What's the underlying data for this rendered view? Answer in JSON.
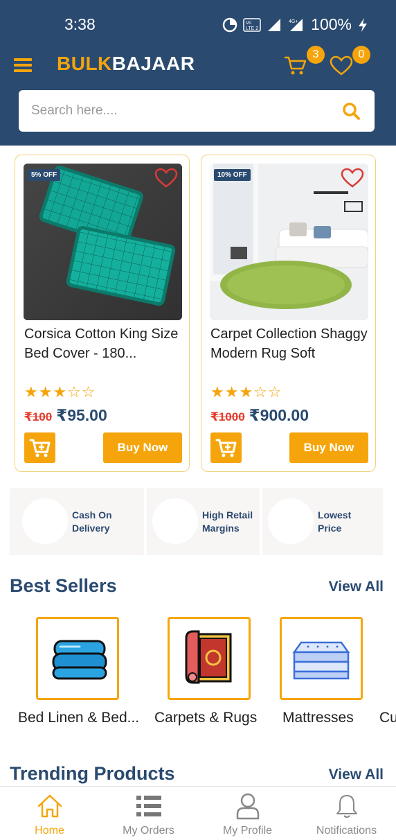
{
  "status_bar": {
    "time": "3:38",
    "volte": "Vo LTE 2",
    "network": "4G+",
    "battery": "100%"
  },
  "header": {
    "brand_part1": "BULK",
    "brand_part2": "BAJAAR",
    "cart_count": "3",
    "wishlist_count": "0"
  },
  "search": {
    "placeholder": "Search here...."
  },
  "products": [
    {
      "discount": "5% OFF",
      "name": "Corsica Cotton King Size Bed Cover - 180...",
      "rating": 3,
      "rating_max": 5,
      "stars": "★★★☆☆",
      "price_old": "₹100",
      "price_new": "₹95.00",
      "buy_label": "Buy Now"
    },
    {
      "discount": "10% OFF",
      "name": "Carpet Collection Shaggy Modern Rug Soft",
      "rating": 3,
      "rating_max": 5,
      "stars": "★★★☆☆",
      "price_old": "₹1000",
      "price_new": "₹900.00",
      "buy_label": "Buy Now"
    }
  ],
  "features": [
    {
      "line1": "Cash On",
      "line2": "Delivery"
    },
    {
      "line1": "High Retail",
      "line2": "Margins"
    },
    {
      "line1": "Lowest",
      "line2": "Price"
    }
  ],
  "best_sellers": {
    "title": "Best Sellers",
    "view_all": "View All",
    "categories": [
      {
        "label": "Bed Linen & Bed...",
        "icon": "bed-linen-icon"
      },
      {
        "label": "Carpets & Rugs",
        "icon": "carpet-icon"
      },
      {
        "label": "Mattresses",
        "icon": "mattress-icon"
      },
      {
        "label": "Cu",
        "icon": ""
      }
    ]
  },
  "trending": {
    "title": "Trending Products",
    "view_all": "View All"
  },
  "bottom_nav": [
    {
      "label": "Home",
      "icon": "home-icon",
      "active": true
    },
    {
      "label": "My Orders",
      "icon": "list-icon",
      "active": false
    },
    {
      "label": "My Profile",
      "icon": "user-icon",
      "active": false
    },
    {
      "label": "Notifications",
      "icon": "bell-icon",
      "active": false
    }
  ],
  "colors": {
    "primary": "#2a4a70",
    "accent": "#f5a50b",
    "strike": "#e43b2c"
  }
}
